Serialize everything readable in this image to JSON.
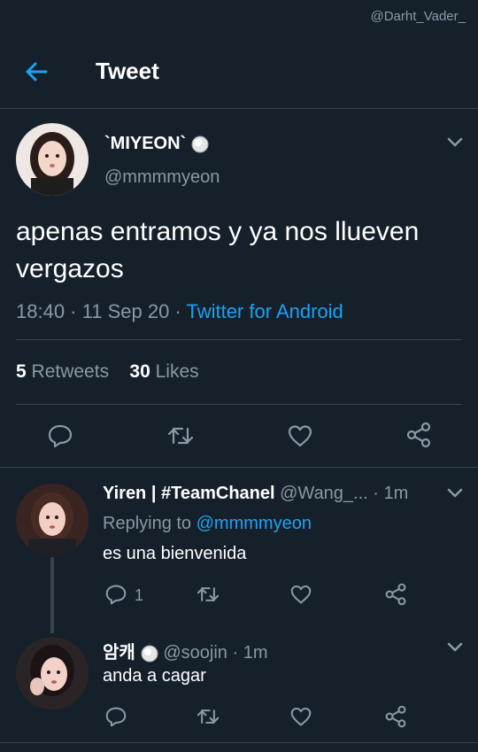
{
  "watermark": "@Darht_Vader_",
  "header": {
    "title": "Tweet"
  },
  "main_tweet": {
    "display_name": "`MIYEON`",
    "handle": "@mmmmyeon",
    "text": "apenas entramos y ya nos llueven vergazos",
    "time": "18:40",
    "date": "11 Sep 20",
    "source": "Twitter for Android",
    "retweets_count": "5",
    "retweets_label": "Retweets",
    "likes_count": "30",
    "likes_label": "Likes"
  },
  "replies": [
    {
      "display_name": "Yiren | #TeamChanel",
      "handle": "@Wang_...",
      "time": "1m",
      "replying_prefix": "Replying to",
      "replying_to": "@mmmmyeon",
      "text": "es una bienvenida",
      "reply_count": "1"
    },
    {
      "display_name": "암캐",
      "handle": "@soojin",
      "time": "1m",
      "text": "anda a cagar"
    }
  ],
  "colors": {
    "background": "#15202b",
    "text": "#ffffff",
    "secondary": "#8899a6",
    "accent": "#1da1f2",
    "divider": "#38444d"
  },
  "icons": [
    "back-arrow-icon",
    "chevron-down-icon",
    "reply-icon",
    "retweet-icon",
    "like-icon",
    "share-icon",
    "badge-icon"
  ]
}
